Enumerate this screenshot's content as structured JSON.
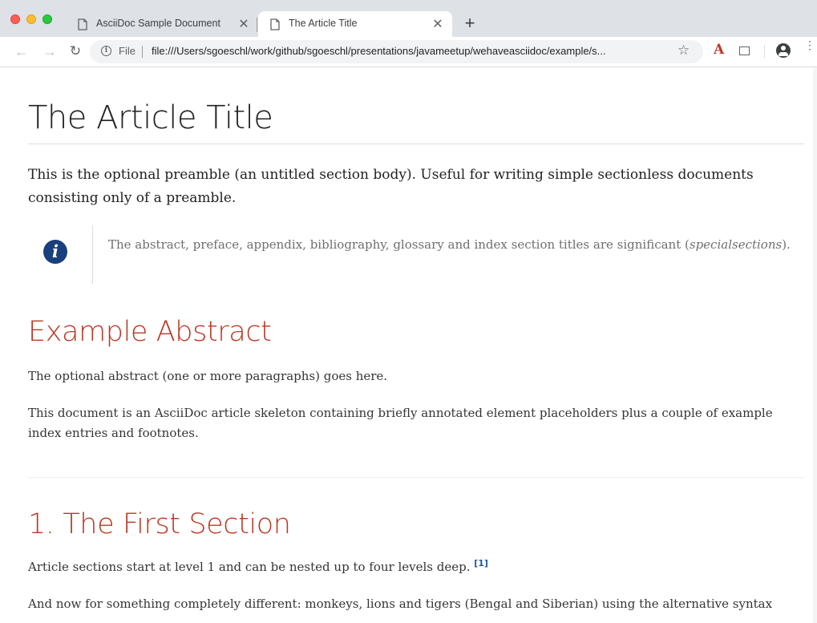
{
  "browser": {
    "tabs": [
      {
        "label": "AsciiDoc Sample Document",
        "close": "✕",
        "active": false
      },
      {
        "label": "The Article Title",
        "close": "✕",
        "active": true
      }
    ],
    "new_tab": "+",
    "toolbar": {
      "back": "←",
      "forward": "→",
      "reload": "↻",
      "info": "i",
      "scheme_label": "File",
      "url": "file:///Users/sgoeschl/work/github/sgoeschl/presentations/javameetup/wehaveasciidoc/example/s...",
      "star": "☆",
      "extension_label": "A",
      "menu": "⋮"
    },
    "icons": [
      "page-icon",
      "close-icon",
      "plus-icon",
      "back-arrow-icon",
      "forward-arrow-icon",
      "reload-icon",
      "info-icon",
      "star-icon",
      "acrobat-extension-icon",
      "screen-capture-icon",
      "profile-icon",
      "menu-dots-icon"
    ]
  },
  "document": {
    "title": "The Article Title",
    "preamble": "This is the optional preamble (an untitled section body). Useful for writing simple sectionless documents consisting only of a preamble.",
    "note": {
      "icon_glyph": "i",
      "text_before": "The abstract, preface, appendix, bibliography, glossary and index section titles are significant (",
      "emphasis": "specialsections",
      "text_after": ")."
    },
    "abstract": {
      "heading": "Example Abstract",
      "paragraphs": [
        "The optional abstract (one or more paragraphs) goes here.",
        "This document is an AsciiDoc article skeleton containing briefly annotated element placeholders plus a couple of example index entries and footnotes."
      ]
    },
    "section1": {
      "heading": "1. The First Section",
      "paragraph1": "Article sections start at level 1 and can be nested up to four levels deep.",
      "footnote_ref": "[1]",
      "paragraph2": "And now for something completely different: monkeys, lions and tigers (Bengal and Siberian) using the alternative syntax"
    }
  },
  "colors": {
    "heading_red": "#ba3925",
    "admonition_blue": "#19407c",
    "link_blue": "#2156a5",
    "tabstrip_bg": "#dee1e6"
  }
}
